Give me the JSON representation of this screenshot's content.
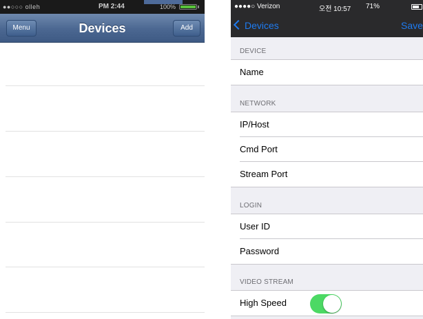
{
  "left_phone": {
    "status_bar": {
      "signal": "●●○○○ olleh",
      "time": "PM 2:44",
      "battery_text": "100%",
      "battery_level": 1.0
    },
    "nav_bar": {
      "title": "Devices",
      "menu_label": "Menu",
      "add_label": "Add"
    },
    "rows": [
      "",
      "",
      "",
      "",
      "",
      ""
    ]
  },
  "right_phone": {
    "status_bar": {
      "carrier": "●●●●○ Verizon",
      "time": "오전 10:57",
      "battery_text": "71%",
      "battery_level": 0.71
    },
    "nav_bar": {
      "back_label": "Devices",
      "save_label": "Save"
    },
    "sections": {
      "device": {
        "header": "DEVICE",
        "items": [
          "Name"
        ]
      },
      "network": {
        "header": "NETWORK",
        "items": [
          "IP/Host",
          "Cmd Port",
          "Stream Port"
        ]
      },
      "login": {
        "header": "LOGIN",
        "items": [
          "User ID",
          "Password"
        ]
      },
      "video_stream": {
        "header": "VIDEO STREAM",
        "items": [
          "High Speed"
        ],
        "high_speed_on": true
      }
    },
    "colors": {
      "accent": "#1e7bf0",
      "toggle_on": "#4cd964",
      "nav_old_blue": "#4b6791"
    }
  }
}
